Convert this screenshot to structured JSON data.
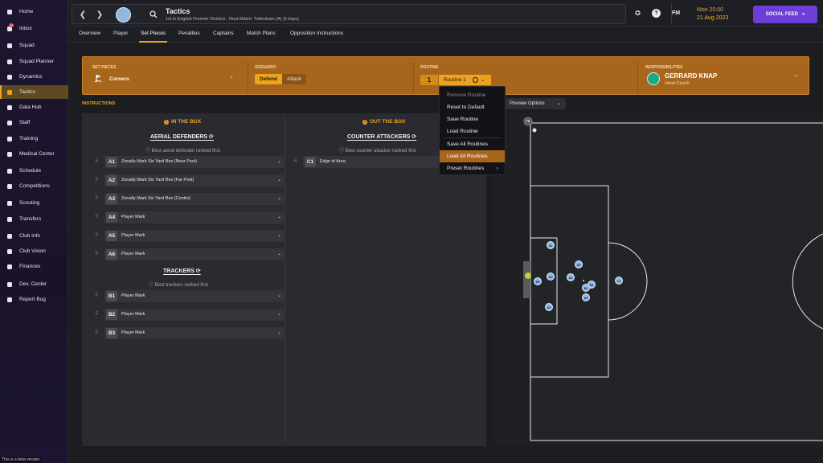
{
  "sidebar": {
    "items": [
      {
        "label": "Home",
        "icon": "home-icon"
      },
      {
        "label": "Inbox",
        "icon": "inbox-icon",
        "badge": "12"
      },
      {
        "label": "Squad",
        "icon": "shirt-icon"
      },
      {
        "label": "Squad Planner",
        "icon": "planner-icon"
      },
      {
        "label": "Dynamics",
        "icon": "dynamics-icon"
      },
      {
        "label": "Tactics",
        "icon": "tactics-icon",
        "active": true
      },
      {
        "label": "Data Hub",
        "icon": "data-hub-icon"
      },
      {
        "label": "Staff",
        "icon": "staff-icon"
      },
      {
        "label": "Training",
        "icon": "training-icon"
      },
      {
        "label": "Medical Center",
        "icon": "medical-icon"
      },
      {
        "label": "Schedule",
        "icon": "schedule-icon"
      },
      {
        "label": "Competitions",
        "icon": "trophy-icon"
      },
      {
        "label": "Scouting",
        "icon": "scouting-icon"
      },
      {
        "label": "Transfers",
        "icon": "transfers-icon"
      },
      {
        "label": "Club Info",
        "icon": "club-info-icon"
      },
      {
        "label": "Club Vision",
        "icon": "vision-icon"
      },
      {
        "label": "Finances",
        "icon": "finances-icon"
      },
      {
        "label": "Dev. Center",
        "icon": "dev-center-icon"
      },
      {
        "label": "Report Bug",
        "icon": "report-bug-icon"
      }
    ],
    "beta_text": "This is a beta version"
  },
  "header": {
    "title": "Tactics",
    "subtitle": "1st in English Premier Division - Next Match: Tottenham (A) (5 days)",
    "fm_label": "FM",
    "time": "Mon 20:00",
    "date": "21 Aug 2023",
    "social_feed": "SOCIAL FEED"
  },
  "tabs": [
    "Overview",
    "Player",
    "Set Pieces",
    "Penalties",
    "Captains",
    "Match Plans",
    "Opposition Instructions"
  ],
  "active_tab": "Set Pieces",
  "set_pieces": {
    "label": "SET PIECES",
    "value": "Corners",
    "scenario_label": "SCENARIO",
    "scenario_options": [
      "Defend",
      "Attack"
    ],
    "scenario_selected": "Defend",
    "routine_label": "ROUTINE",
    "routine_number": "1",
    "routine_value": "Routine 1",
    "responsibilities_label": "RESPONSIBILITIES",
    "coach_name": "GERRARD KNAP",
    "coach_role": "Head Coach"
  },
  "instructions_label": "INSTRUCTIONS",
  "in_the_box": {
    "title": "IN THE BOX",
    "aerial_title": "AERIAL DEFENDERS",
    "aerial_hint": "Best aerial defender ranked first",
    "aerial_rows": [
      {
        "code": "A1",
        "text": "Zonally Mark Six Yard Box (Near Post)"
      },
      {
        "code": "A2",
        "text": "Zonally Mark Six Yard Box (Far Post)"
      },
      {
        "code": "A3",
        "text": "Zonally Mark Six Yard Box (Centre)"
      },
      {
        "code": "A4",
        "text": "Player Mark"
      },
      {
        "code": "A5",
        "text": "Player Mark"
      },
      {
        "code": "A6",
        "text": "Player Mark"
      }
    ],
    "trackers_title": "TRACKERS",
    "trackers_hint": "Best trackers ranked first",
    "tracker_rows": [
      {
        "code": "B1",
        "text": "Player Mark"
      },
      {
        "code": "B2",
        "text": "Player Mark"
      },
      {
        "code": "B3",
        "text": "Player Mark"
      }
    ]
  },
  "out_the_box": {
    "title": "OUT THE BOX",
    "counter_title": "COUNTER ATTACKERS",
    "counter_hint": "Best counter attacker ranked first",
    "counter_rows": [
      {
        "code": "C1",
        "text": "Edge of Area"
      }
    ]
  },
  "preview_options": "Preview Options",
  "routine_menu": {
    "items": [
      {
        "label": "Remove Routine",
        "disabled": true
      },
      {
        "label": "Reset to Default"
      },
      {
        "label": "Save Routine"
      },
      {
        "label": "Load Routine"
      },
      {
        "label": "Save All Routines"
      },
      {
        "label": "Load All Routines",
        "highlighted": true
      },
      {
        "label": "Preset Routines",
        "submenu": true
      }
    ]
  },
  "pitch": {
    "markers": [
      "TK",
      "A1",
      "A6",
      "B3",
      "A3",
      "A4",
      "B1",
      "B2",
      "A5",
      "C1",
      "A2"
    ]
  },
  "colors": {
    "accent": "#f0a21e",
    "panel_orange": "#a8661c",
    "social_feed": "#6d3fd8",
    "player_marker": "#8fb8e8"
  }
}
